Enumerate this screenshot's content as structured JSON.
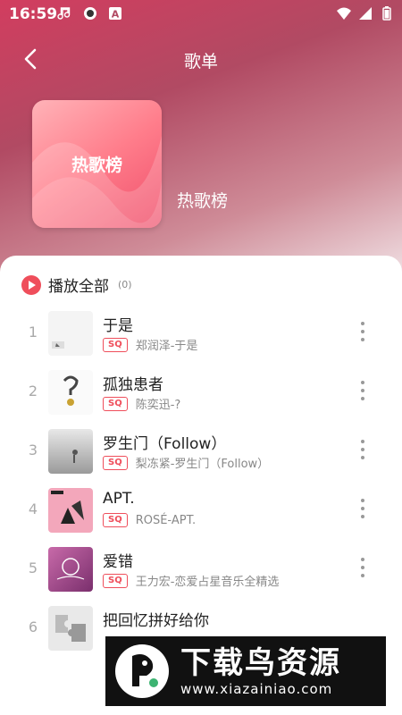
{
  "status_bar": {
    "time": "16:59",
    "left_icons": [
      "music-note-icon",
      "record-icon",
      "a-badge-icon"
    ],
    "right_icons": [
      "wifi-icon",
      "signal-icon",
      "battery-icon"
    ]
  },
  "header": {
    "title": "歌单",
    "back_icon": "chevron-left-icon"
  },
  "playlist": {
    "cover_text": "热歌榜",
    "name": "热歌榜",
    "cover_color": "#ff7d8b"
  },
  "play_all": {
    "label": "播放全部",
    "count": "(0)",
    "accent": "#ef4e5b"
  },
  "quality_badge": "SQ",
  "songs": [
    {
      "index": "1",
      "title": "于是",
      "subtitle": "郑润泽-于是"
    },
    {
      "index": "2",
      "title": "孤独患者",
      "subtitle": "陈奕迅-?"
    },
    {
      "index": "3",
      "title": "罗生门（Follow）",
      "subtitle": "梨冻紧-罗生门（Follow）"
    },
    {
      "index": "4",
      "title": "APT.",
      "subtitle": "ROSÉ-APT."
    },
    {
      "index": "5",
      "title": "爱错",
      "subtitle": "王力宏-恋爱占星音乐全精选"
    },
    {
      "index": "6",
      "title": "把回忆拼好给你",
      "subtitle": ""
    }
  ],
  "watermark": {
    "title": "下载鸟资源",
    "url": "www.xiazainiao.com"
  }
}
